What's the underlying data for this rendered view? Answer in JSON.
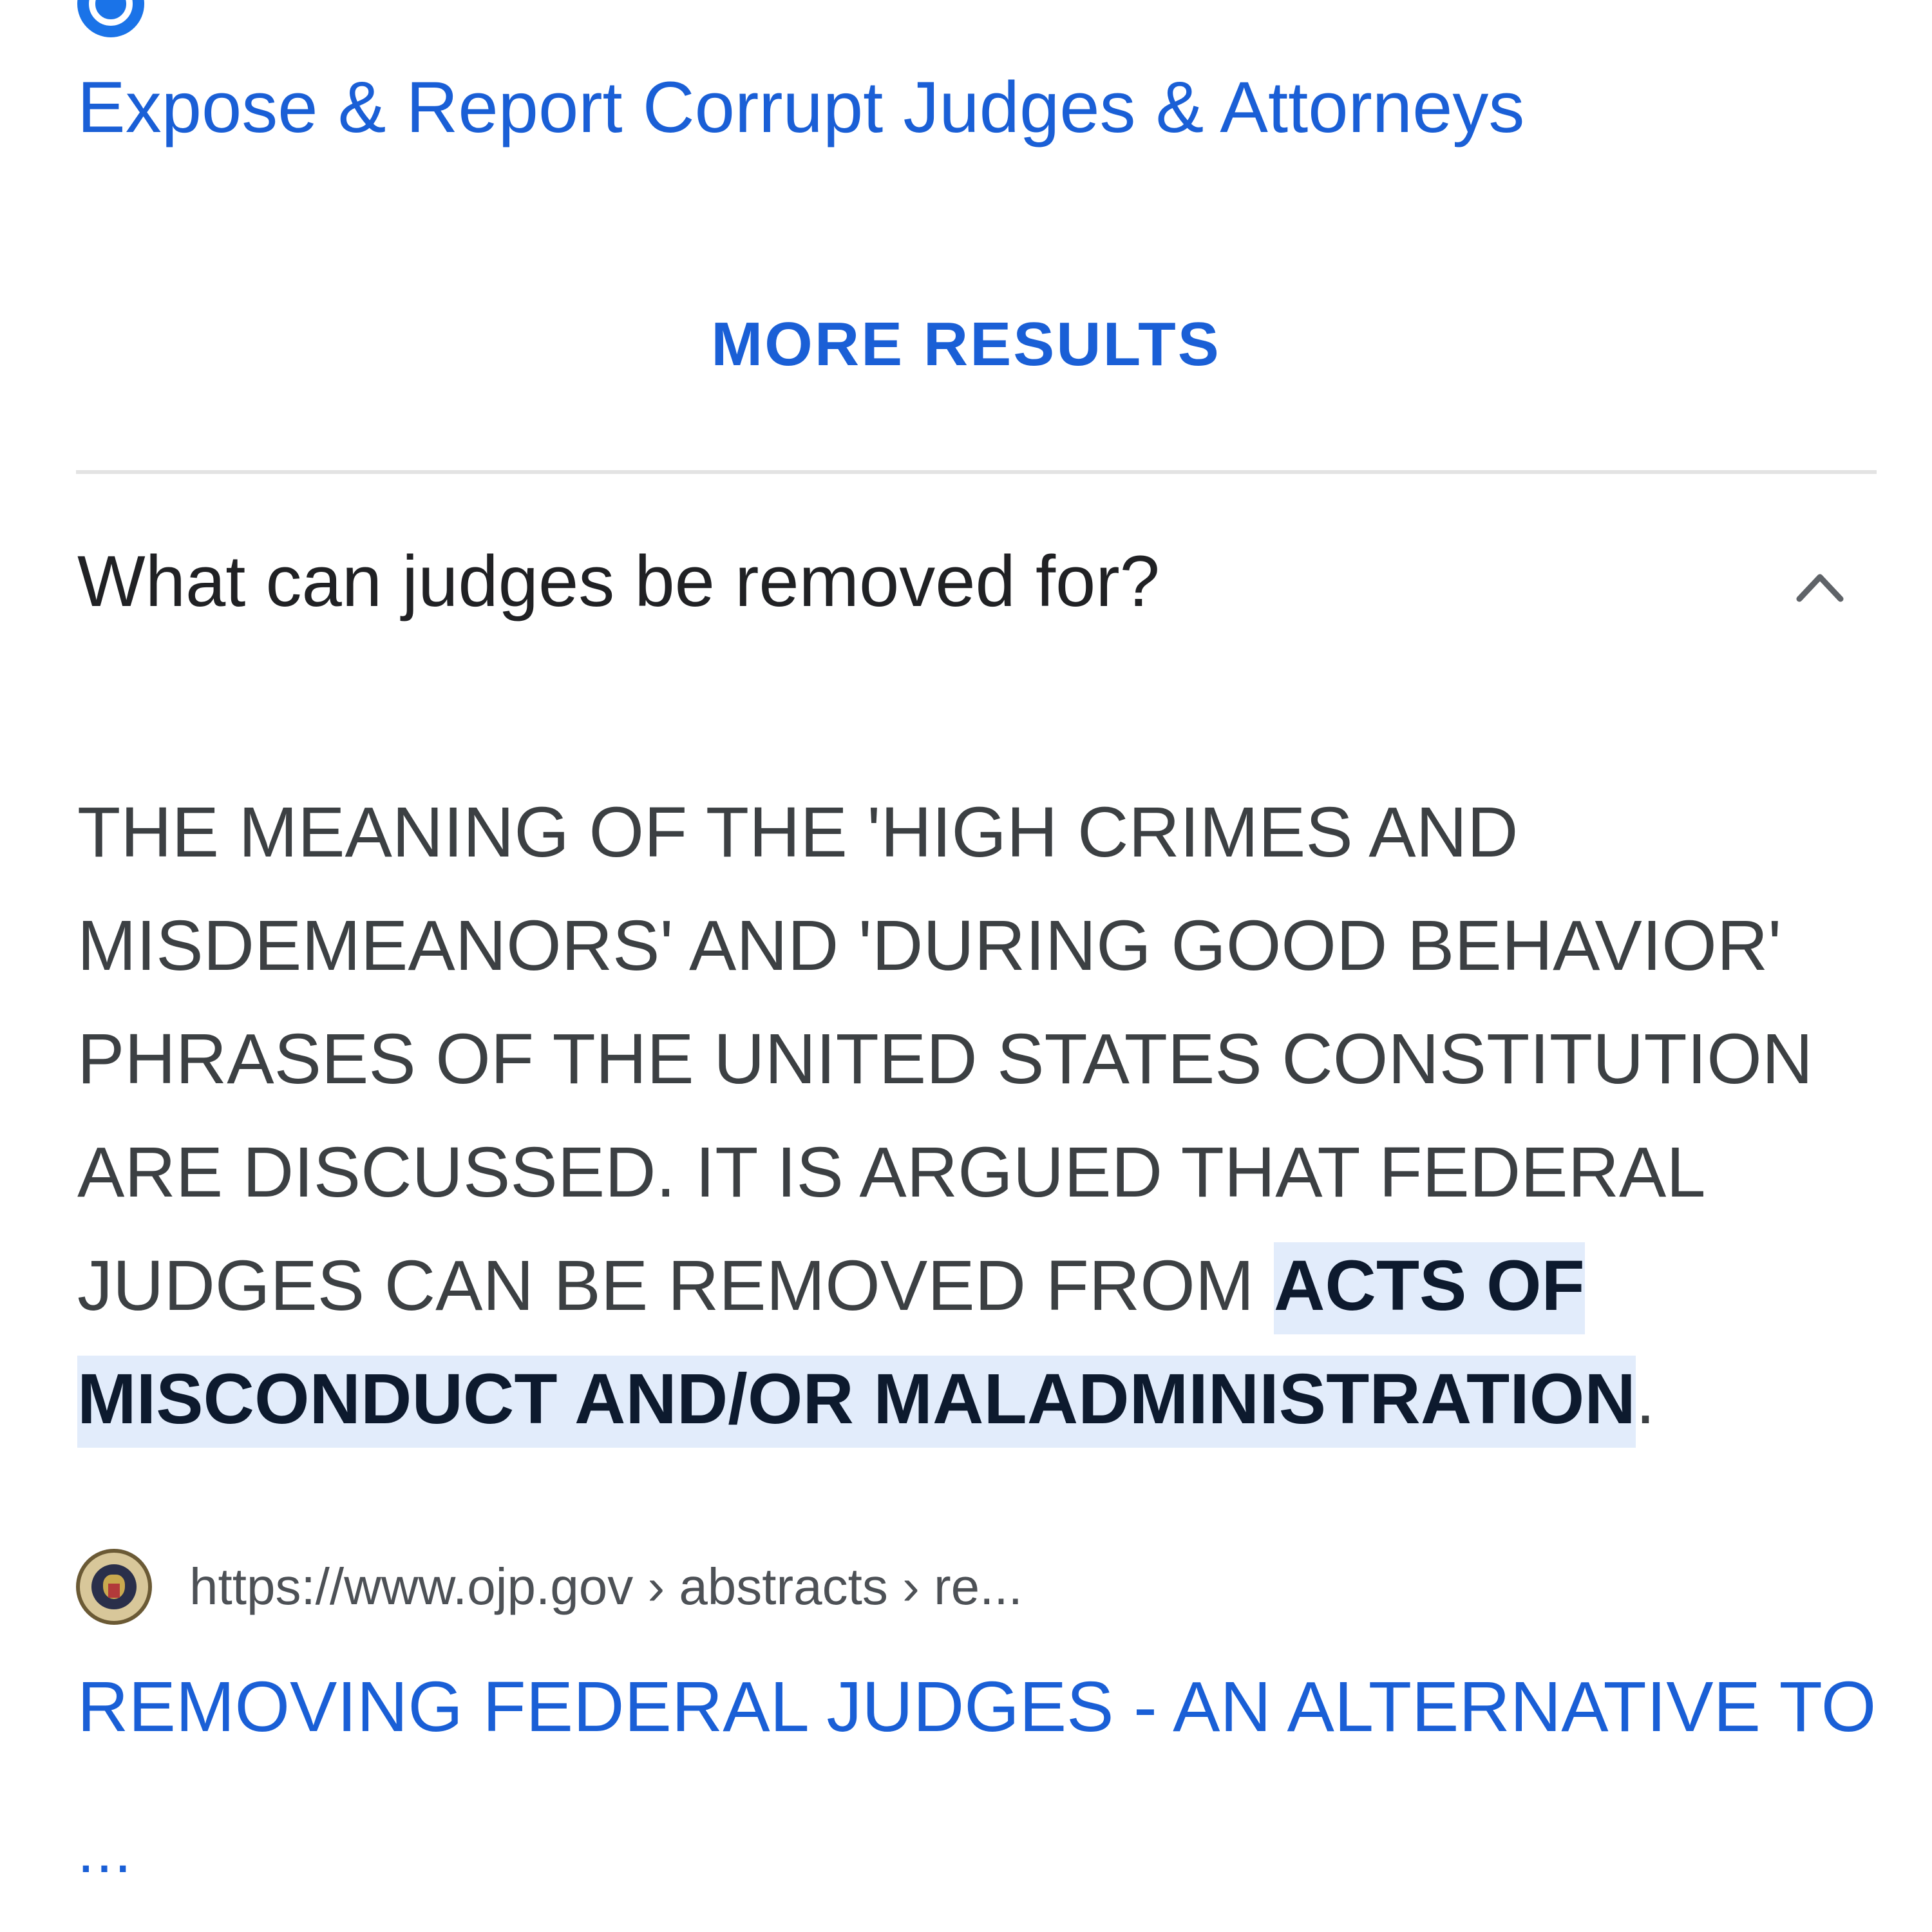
{
  "results": {
    "first_title": "Expose & Report Corrupt Judges & Attorneys",
    "more_results_label": "MORE RESULTS"
  },
  "faq": {
    "question": "What can judges be removed for?",
    "expanded": true,
    "answer_lines": [
      "THE MEANING OF THE 'HIGH CRIMES AND",
      "MISDEMEANORS' AND 'DURING GOOD BEHAVIOR'",
      "PHRASES OF THE UNITED STATES CONSTITUTION",
      "ARE DISCUSSED. IT IS ARGUED THAT FEDERAL"
    ],
    "answer_line5_prefix": "JUDGES CAN BE REMOVED FROM ",
    "answer_highlight_part1": "ACTS OF",
    "answer_highlight_part2": "MISCONDUCT AND/OR MALADMINISTRATION",
    "answer_suffix": ".",
    "source_url": "https://www.ojp.gov › abstracts › re...",
    "source_title": "REMOVING FEDERAL JUDGES - AN ALTERNATIVE TO",
    "source_title_continuation": "..."
  },
  "colors": {
    "link": "#1a5fd6",
    "highlight_bg": "#e2ecfb",
    "text": "#202124",
    "muted": "#4d5156"
  },
  "icons": {
    "top_favicon": "globe-icon",
    "chevron": "chevron-up-icon",
    "source_favicon": "doj-seal-icon"
  }
}
